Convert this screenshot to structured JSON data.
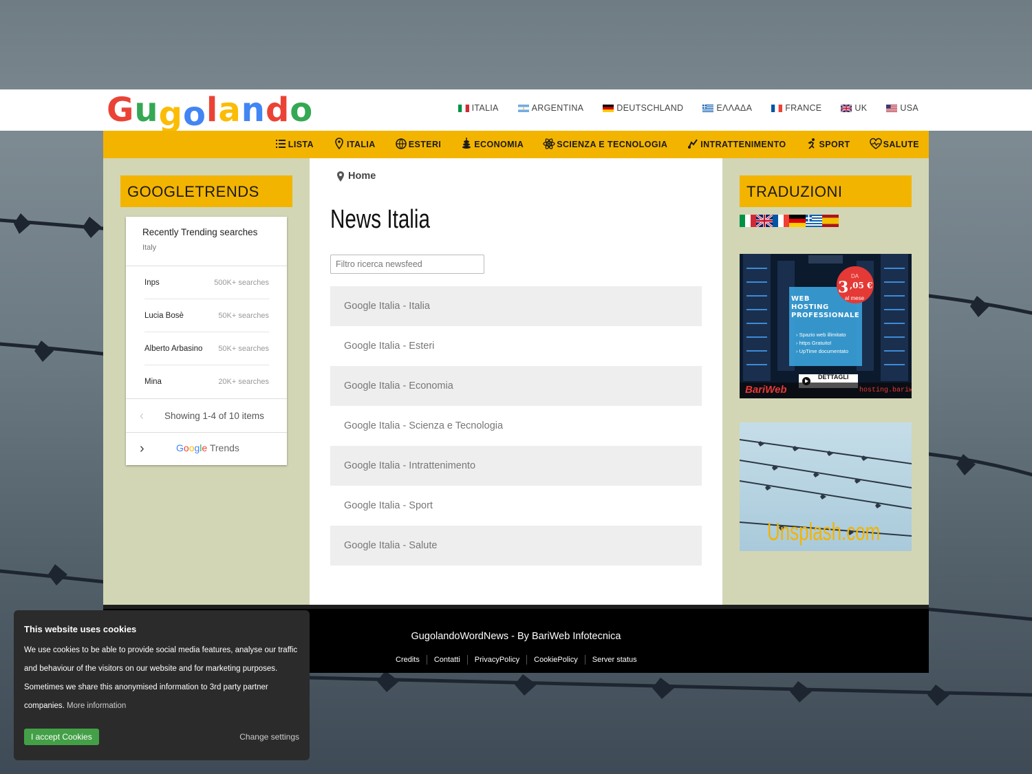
{
  "logo": {
    "letters": [
      "G",
      "u",
      "g",
      "o",
      "l",
      "a",
      "n",
      "d",
      "o"
    ],
    "colors": [
      "#ea4335",
      "#34a853",
      "#fbbc05",
      "#4285f4",
      "#ea4335",
      "#fbbc05",
      "#4285f4",
      "#ea4335",
      "#34a853"
    ]
  },
  "countries": [
    {
      "label": "ITALIA",
      "flag": "it"
    },
    {
      "label": "ARGENTINA",
      "flag": "ar"
    },
    {
      "label": "DEUTSCHLAND",
      "flag": "de"
    },
    {
      "label": "ΕΛΛΑΔΑ",
      "flag": "gr"
    },
    {
      "label": "FRANCE",
      "flag": "fr"
    },
    {
      "label": "UK",
      "flag": "uk"
    },
    {
      "label": "USA",
      "flag": "us"
    }
  ],
  "nav": [
    {
      "label": "LISTA",
      "icon": "list-icon"
    },
    {
      "label": "ITALIA",
      "icon": "map-pin-icon"
    },
    {
      "label": "ESTERI",
      "icon": "globe-icon"
    },
    {
      "label": "ECONOMIA",
      "icon": "coins-icon"
    },
    {
      "label": "SCIENZA E TECNOLOGIA",
      "icon": "atom-icon"
    },
    {
      "label": "INTRATTENIMENTO",
      "icon": "music-icon"
    },
    {
      "label": "SPORT",
      "icon": "running-icon"
    },
    {
      "label": "SALUTE",
      "icon": "heart-pulse-icon"
    }
  ],
  "left_sidebar": {
    "title": "GOOGLETRENDS",
    "widget": {
      "title": "Recently Trending searches",
      "region": "Italy",
      "rows": [
        {
          "term": "Inps",
          "count": "500K+ searches"
        },
        {
          "term": "Lucia Bosè",
          "count": "50K+ searches"
        },
        {
          "term": "Alberto Arbasino",
          "count": "50K+ searches"
        },
        {
          "term": "Mina",
          "count": "20K+ searches"
        }
      ],
      "pager": "Showing 1-4 of 10 items",
      "brand_google": "Google",
      "brand_trends": "Trends"
    }
  },
  "breadcrumb": {
    "label": "Home"
  },
  "main": {
    "title": "News Italia",
    "filter_placeholder": "Filtro ricerca newsfeed",
    "feeds": [
      "Google Italia - Italia",
      "Google Italia - Esteri",
      "Google Italia - Economia",
      "Google Italia - Scienza e Tecnologia",
      "Google Italia - Intrattenimento",
      "Google Italia - Sport",
      "Google Italia - Salute"
    ]
  },
  "right_sidebar": {
    "title": "TRADUZIONI",
    "translation_flags": [
      "it",
      "uk",
      "fr",
      "de",
      "gr",
      "es"
    ],
    "hosting_ad": {
      "price_prefix": "DA",
      "price_int": "3",
      "price_dec": ",05 €",
      "price_suffix": "al mese",
      "headline_1": "WEB",
      "headline_2": "HOSTING",
      "headline_3": "PROFESSIONALE",
      "bullets": [
        "Spazio web illimitato",
        "https Gratuito!",
        "UpTime documentato"
      ],
      "cta": "DETTAGLI",
      "brand": "BariWeb",
      "url": "hosting.bariweb.it"
    },
    "unsplash_ad": {
      "text": "Unsplash.com"
    }
  },
  "footer": {
    "title": "GugolandoWordNews - By BariWeb Infotecnica",
    "links": [
      "Credits",
      "Contatti",
      "PrivacyPolicy",
      "CookiePolicy",
      "Server status"
    ]
  },
  "cookie": {
    "title": "This website uses cookies",
    "body": "We use cookies to be able to provide social media features, analyse our traffic and behaviour of the visitors on our website and for marketing purposes. Sometimes we share this anonymised information to 3rd party partner companies.",
    "more": "More information",
    "accept": "I accept Cookies",
    "change": "Change settings"
  },
  "colors": {
    "accent": "#f3b400",
    "sidebar_bg": "#d2d6b4",
    "accept_green": "#43a047",
    "footer_bg": "#000000"
  }
}
